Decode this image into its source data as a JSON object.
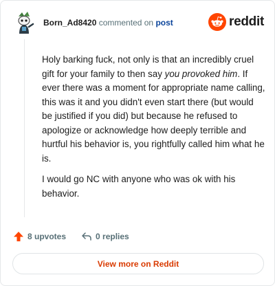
{
  "header": {
    "username": "Born_Ad8420",
    "action_text": "commented on",
    "post_link": "post",
    "brand_word": "reddit",
    "avatar_icon": "snoo-avatar-icon",
    "brand_icon": "reddit-logo-icon"
  },
  "comment": {
    "p1_a": "Holy barking fuck, not only is that an incredibly cruel gift for your family to then say ",
    "p1_em": "you provoked him",
    "p1_b": ". If ever there was a moment for appropriate name calling, this was it and you didn't even start there (but would be justified if you did) but because he refused to apologize or acknowledge how deeply terrible and hurtful his behavior is, you rightfully called him what he is.",
    "p2": "I would go NC with anyone who was ok with his behavior."
  },
  "actions": {
    "upvotes_label": "8 upvotes",
    "replies_label": "0 replies",
    "upvote_icon": "upvote-arrow-icon",
    "reply_icon": "reply-arrow-icon"
  },
  "footer": {
    "view_more_label": "View more on Reddit"
  },
  "colors": {
    "brand_orange": "#ff4500",
    "link_blue": "#0a449b",
    "muted_gray": "#576f76",
    "view_more_text": "#d93a00"
  }
}
